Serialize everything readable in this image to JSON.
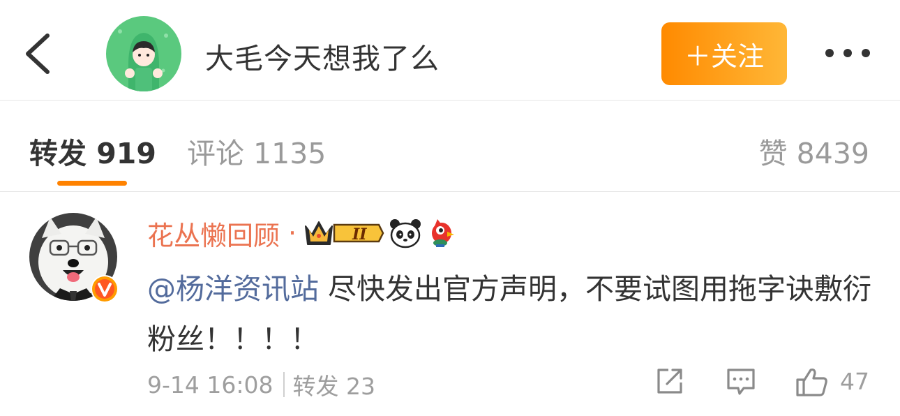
{
  "header": {
    "back_icon": "chevron-left-icon",
    "title": "大毛今天想我了么",
    "follow_label": "＋关注",
    "more_icon": "more-dots-icon"
  },
  "tabs": {
    "repost_label": "转发 919",
    "comment_label": "评论 1135",
    "like_label": "赞 8439",
    "active": "转发",
    "accent": "#ff8200"
  },
  "comment": {
    "author": "花丛懒回顾",
    "separator": "·",
    "badges": [
      "crown-vip-II-icon",
      "panda-icon",
      "weibo-bird-icon"
    ],
    "verified_icon": "verified-v-icon",
    "mention": "@杨洋资讯站",
    "text": " 尽快发出官方声明，不要试图用拖字诀敷衍粉丝！！！！",
    "time": "9-14 16:08",
    "repost_text": "转发 23",
    "like_count": "47",
    "name_color": "#eb7350",
    "mention_color": "#536b9c"
  }
}
